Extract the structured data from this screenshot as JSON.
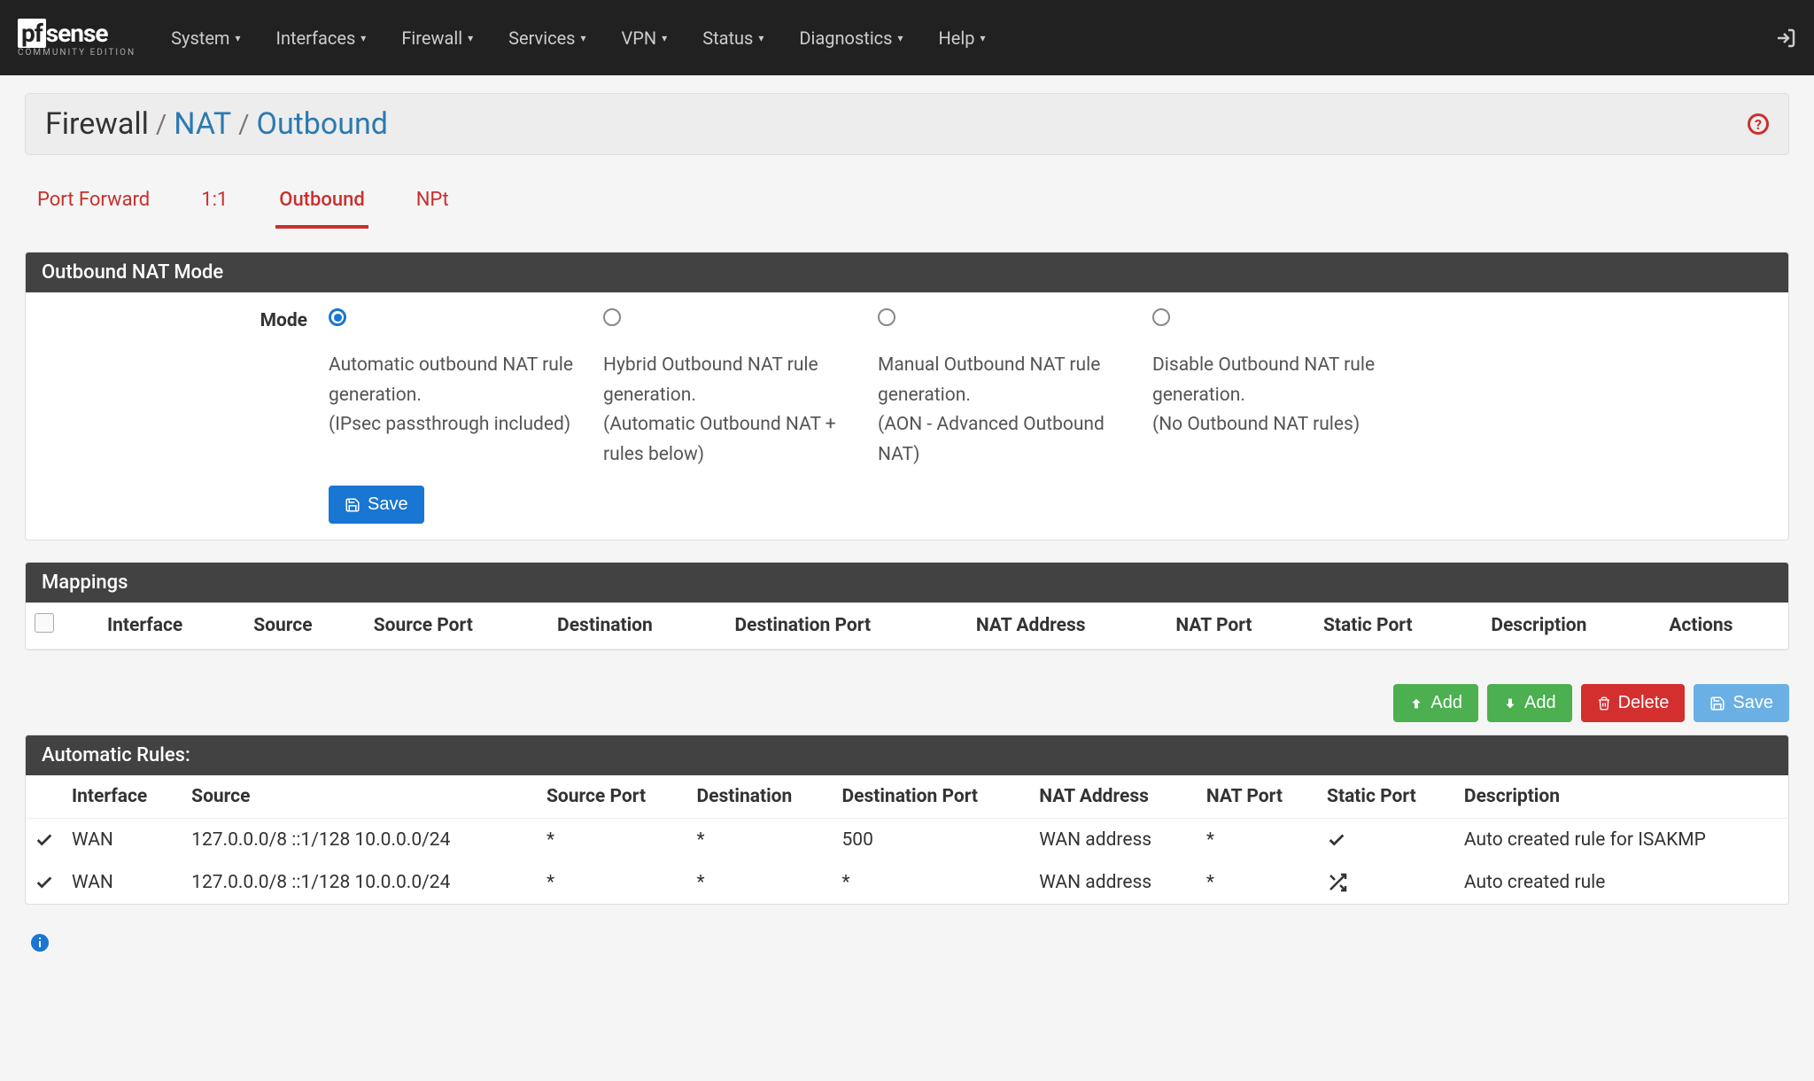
{
  "logo": {
    "pf": "pf",
    "sense": "sense",
    "subtitle": "COMMUNITY EDITION"
  },
  "nav": {
    "items": [
      "System",
      "Interfaces",
      "Firewall",
      "Services",
      "VPN",
      "Status",
      "Diagnostics",
      "Help"
    ]
  },
  "breadcrumb": {
    "a": "Firewall",
    "b": "NAT",
    "c": "Outbound"
  },
  "tabs": {
    "items": [
      {
        "label": "Port Forward",
        "active": false
      },
      {
        "label": "1:1",
        "active": false
      },
      {
        "label": "Outbound",
        "active": true
      },
      {
        "label": "NPt",
        "active": false
      }
    ]
  },
  "panel_mode": {
    "title": "Outbound NAT Mode",
    "label": "Mode",
    "options": [
      {
        "selected": true,
        "desc": "Automatic outbound NAT rule generation.\n(IPsec passthrough included)"
      },
      {
        "selected": false,
        "desc": "Hybrid Outbound NAT rule generation.\n(Automatic Outbound NAT + rules below)"
      },
      {
        "selected": false,
        "desc": "Manual Outbound NAT rule generation.\n(AON - Advanced Outbound NAT)"
      },
      {
        "selected": false,
        "desc": "Disable Outbound NAT rule generation.\n(No Outbound NAT rules)"
      }
    ],
    "save_label": "Save"
  },
  "panel_mappings": {
    "title": "Mappings",
    "headers": [
      "Interface",
      "Source",
      "Source Port",
      "Destination",
      "Destination Port",
      "NAT Address",
      "NAT Port",
      "Static Port",
      "Description",
      "Actions"
    ],
    "actions": {
      "add1": "Add",
      "add2": "Add",
      "delete": "Delete",
      "save": "Save"
    }
  },
  "panel_auto": {
    "title": "Automatic Rules:",
    "headers": [
      "Interface",
      "Source",
      "Source Port",
      "Destination",
      "Destination Port",
      "NAT Address",
      "NAT Port",
      "Static Port",
      "Description"
    ],
    "rows": [
      {
        "interface": "WAN",
        "source": "127.0.0.0/8 ::1/128 10.0.0.0/24",
        "src_port": "*",
        "dest": "*",
        "dest_port": "500",
        "nat_addr": "WAN address",
        "nat_port": "*",
        "static_port": "check",
        "desc": "Auto created rule for ISAKMP"
      },
      {
        "interface": "WAN",
        "source": "127.0.0.0/8 ::1/128 10.0.0.0/24",
        "src_port": "*",
        "dest": "*",
        "dest_port": "*",
        "nat_addr": "WAN address",
        "nat_port": "*",
        "static_port": "shuffle",
        "desc": "Auto created rule"
      }
    ]
  }
}
